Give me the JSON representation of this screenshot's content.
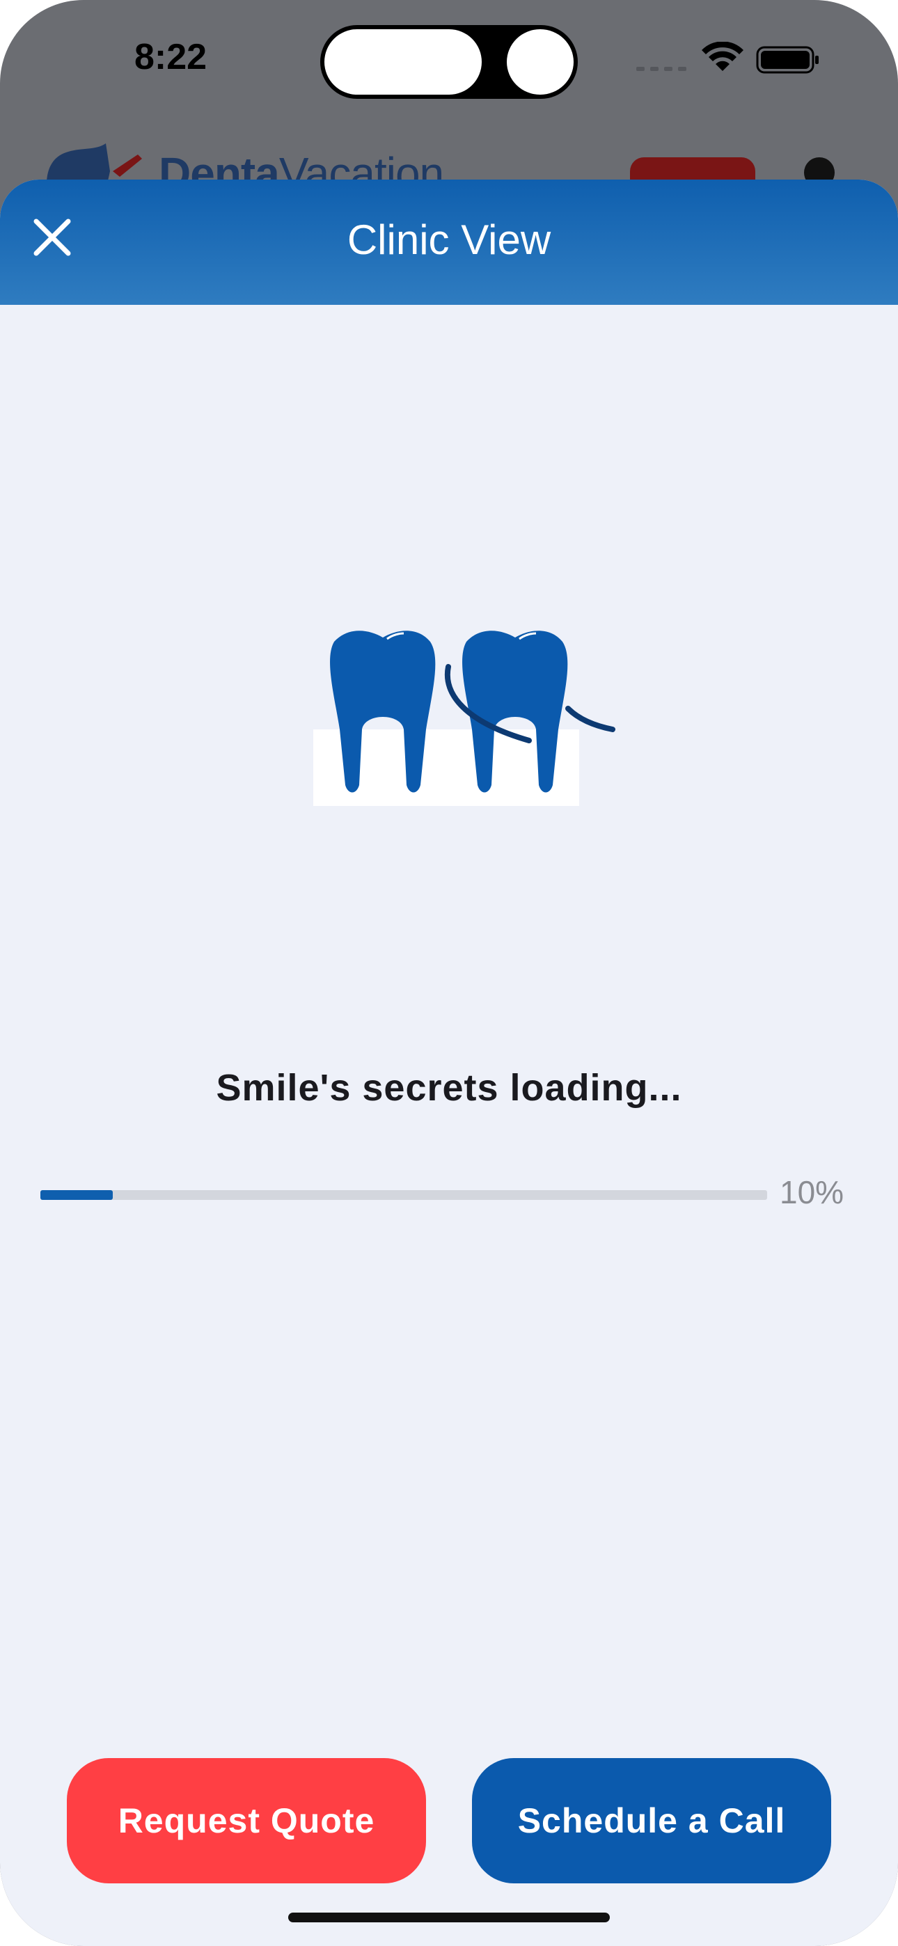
{
  "status_bar": {
    "time": "8:22"
  },
  "background_app": {
    "brand_bold": "Denta",
    "brand_light": "Vacation"
  },
  "sheet": {
    "title": "Clinic View",
    "close_icon": "close-icon"
  },
  "loading": {
    "message": "Smile's secrets loading...",
    "progress_fraction": 0.1,
    "progress_label": "10%"
  },
  "actions": {
    "request_quote_label": "Request Quote",
    "schedule_call_label": "Schedule a Call"
  },
  "colors": {
    "header_blue": "#0f5fae",
    "accent_red": "#ff3f44",
    "primary_blue": "#0b5aad",
    "sheet_bg": "#eef1f9"
  }
}
